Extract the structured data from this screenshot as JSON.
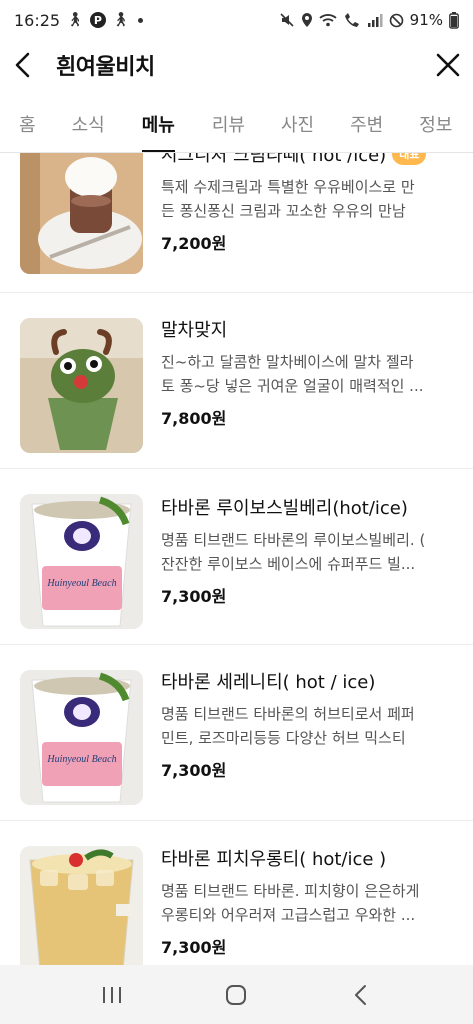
{
  "status_bar": {
    "time": "16:25",
    "battery": "91%",
    "icons": [
      "walk-icon",
      "parking-icon",
      "walk-icon",
      "dot-icon",
      "mute-icon",
      "location-icon",
      "wifi-icon",
      "wifi-call-icon",
      "signal-icon",
      "dnd-icon",
      "battery-icon"
    ]
  },
  "header": {
    "title": "흰여울비치",
    "back_icon": "chevron-left-icon",
    "close_icon": "close-icon"
  },
  "tabs": [
    {
      "label": "홈",
      "active": false
    },
    {
      "label": "소식",
      "active": false
    },
    {
      "label": "메뉴",
      "active": true
    },
    {
      "label": "리뷰",
      "active": false
    },
    {
      "label": "사진",
      "active": false
    },
    {
      "label": "주변",
      "active": false
    },
    {
      "label": "정보",
      "active": false
    }
  ],
  "menu_items": [
    {
      "name": "시그니처 크림라떼( hot /ice)",
      "badge": "대표",
      "desc_line1": "특제 수제크림과 특별한 우유베이스로 만",
      "desc_line2": "든 퐁신퐁신 크림과 꼬소한 우유의 만남",
      "price": "7,200원"
    },
    {
      "name": "말차맞지",
      "badge": "",
      "desc_line1": "진~하고 달콤한 말차베이스에 말차 젤라",
      "desc_line2": "토 퐁~당 넣은 귀여운 얼굴이 매력적인 ...",
      "price": "7,800원"
    },
    {
      "name": "타바론 루이보스빌베리(hot/ice)",
      "badge": "",
      "desc_line1": "명품 티브랜드 타바론의 루이보스빌베리. (",
      "desc_line2": "잔잔한 루이보스 베이스에 슈퍼푸드 빌...",
      "price": "7,300원",
      "cup_text": "Huinyeoul Beach"
    },
    {
      "name": "타바론 세레니티( hot / ice)",
      "badge": "",
      "desc_line1": "명품 티브랜드 타바론의 허브티로서 페퍼",
      "desc_line2": "민트, 로즈마리등등 다양산 허브 믹스티",
      "price": "7,300원",
      "cup_text": "Huinyeoul Beach"
    },
    {
      "name": "타바론 피치우롱티( hot/ice )",
      "badge": "",
      "desc_line1": "명품 티브랜드 타바론. 피치향이 은은하게",
      "desc_line2": "우롱티와 어우러져 고급스럽고 우와한 ...",
      "price": "7,300원"
    }
  ],
  "navbar": {
    "icons": [
      "recent-apps-icon",
      "home-icon",
      "back-icon"
    ]
  }
}
